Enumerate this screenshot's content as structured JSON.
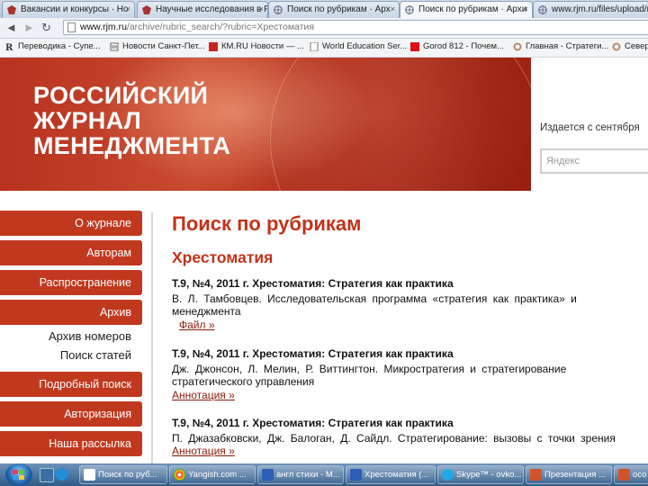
{
  "browser": {
    "tabs": [
      {
        "label": "Вакансии и конкурсы · Но",
        "active": false
      },
      {
        "label": "Научные исследования в Р",
        "active": false
      },
      {
        "label": "Поиск по рубрикам · Арх",
        "active": false
      },
      {
        "label": "Поиск по рубрикам · Архи",
        "active": true
      },
      {
        "label": "www.rjm.ru/files/upload/rjm",
        "active": false
      }
    ],
    "close_glyph": "×",
    "nav": {
      "back": "◄",
      "forward": "►",
      "reload": "↻"
    },
    "address": {
      "domain": "www.rjm.ru",
      "path": "/archive/rubric_search/?rubric=Хрестоматия"
    },
    "bookmarks": [
      {
        "label": "Переводика - Супе..."
      },
      {
        "label": "Новости Санкт-Пет..."
      },
      {
        "label": "КМ.RU Новости — ..."
      },
      {
        "label": "World Education Ser..."
      },
      {
        "label": "Gorod 812 - Почем..."
      },
      {
        "label": "Главная - Стратеги..."
      },
      {
        "label": "Север"
      }
    ]
  },
  "site": {
    "logo_lines": [
      "РОССИЙСКИЙ",
      "ЖУРНАЛ",
      "МЕНЕДЖМЕНТА"
    ],
    "since_text": "Издается с сентября",
    "search_placeholder": "Яндекс",
    "sidebar": {
      "items": [
        {
          "label": "О журнале",
          "type": "button"
        },
        {
          "label": "Авторам",
          "type": "button"
        },
        {
          "label": "Распространение",
          "type": "button"
        },
        {
          "label": "Архив",
          "type": "button"
        },
        {
          "label": "Архив номеров",
          "type": "sub"
        },
        {
          "label": "Поиск статей",
          "type": "sub"
        },
        {
          "label": "Подробный поиск",
          "type": "button"
        },
        {
          "label": "Авторизация",
          "type": "button"
        },
        {
          "label": "Наша рассылка",
          "type": "button"
        }
      ]
    },
    "main": {
      "title": "Поиск по рубрикам",
      "rubric": "Хрестоматия",
      "entries": [
        {
          "title": "Т.9, №4, 2011 г. Хрестоматия: Стратегия как практика",
          "authors_line": "В. Л. Тамбовцев. Исследовательская программа «стратегия как практика» и",
          "continuation": "менеджмента",
          "link": "Файл »"
        },
        {
          "title": "Т.9, №4, 2011 г. Хрестоматия: Стратегия как практика",
          "authors_line": "Дж. Джонсон, Л. Мелин, Р. Виттингтон. Микростратегия и стратегирование",
          "continuation": "стратегического управления",
          "link": "Аннотация »"
        },
        {
          "title": "Т.9, №4, 2011 г. Хрестоматия: Стратегия как практика",
          "authors_line": "П. Джазабковски, Дж. Балоган, Д. Сайдл. Стратегирование: вызовы с точки зрения",
          "continuation": "",
          "link": "Аннотация »"
        }
      ]
    }
  },
  "taskbar": {
    "tasks": [
      {
        "label": "Поиск по руб..."
      },
      {
        "label": "Yangish.com ..."
      },
      {
        "label": "англ стихи - М..."
      },
      {
        "label": "Хрестоматия (..."
      },
      {
        "label": "Skype™ - ovko..."
      },
      {
        "label": "Презентация ..."
      },
      {
        "label": "осо"
      }
    ]
  }
}
